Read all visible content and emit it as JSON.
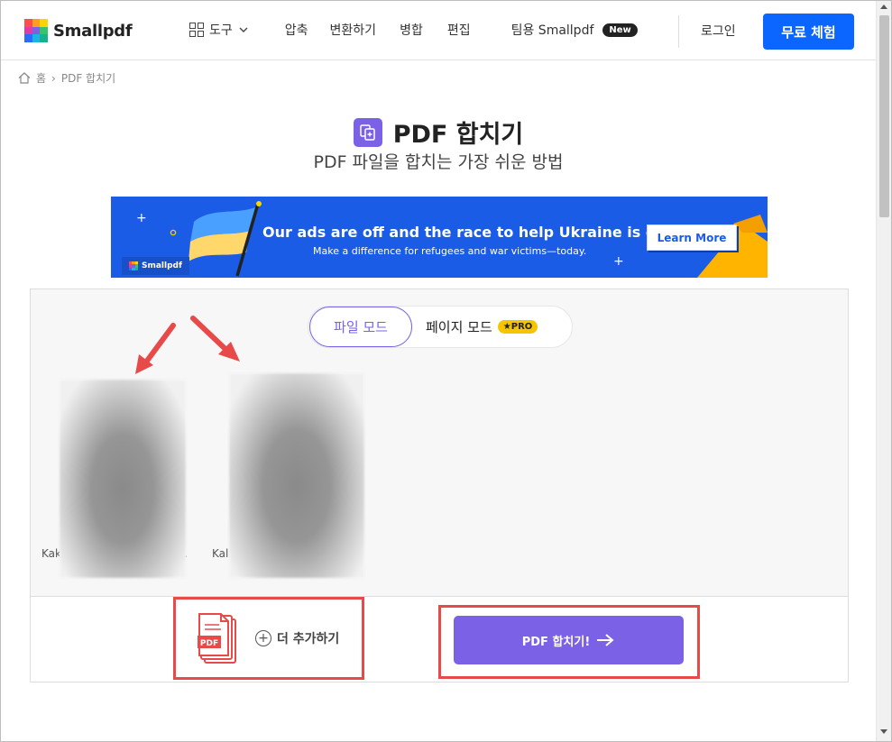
{
  "header": {
    "logo_text": "Smallpdf",
    "nav": {
      "tools": "도구",
      "compress": "압축",
      "convert": "변환하기",
      "merge": "병합",
      "edit": "편집",
      "team": "팀용 Smallpdf",
      "team_badge": "New"
    },
    "login": "로그인",
    "trial_button": "무료 체험"
  },
  "breadcrumb": {
    "home": "홈",
    "separator": "›",
    "current": "PDF 합치기"
  },
  "page": {
    "title": "PDF 합치기",
    "subtitle": "PDF 파일을 합치는 가장 쉬운 방법"
  },
  "banner": {
    "headline": "Our ads are off and the race to help Ukraine is on",
    "subline": "Make a difference for refugees and war victims—today.",
    "button": "Learn More",
    "logo_text": "Smallpdf"
  },
  "workspace": {
    "mode_file": "파일 모드",
    "mode_page": "페이지 모드",
    "pro_badge": "★PRO",
    "files": [
      {
        "label_left": "Kak",
        "label_right": "."
      },
      {
        "label_left": "Kal",
        "label_right": ""
      }
    ],
    "add_more": "더 추가하기",
    "merge_button": "PDF 합치기!",
    "pdf_icon_text": "PDF"
  },
  "colors": {
    "accent": "#7b61e6",
    "primary": "#0a66ff",
    "banner_bg": "#1a5ce6",
    "annotation": "#e84a4a",
    "pro": "#f7c400"
  }
}
